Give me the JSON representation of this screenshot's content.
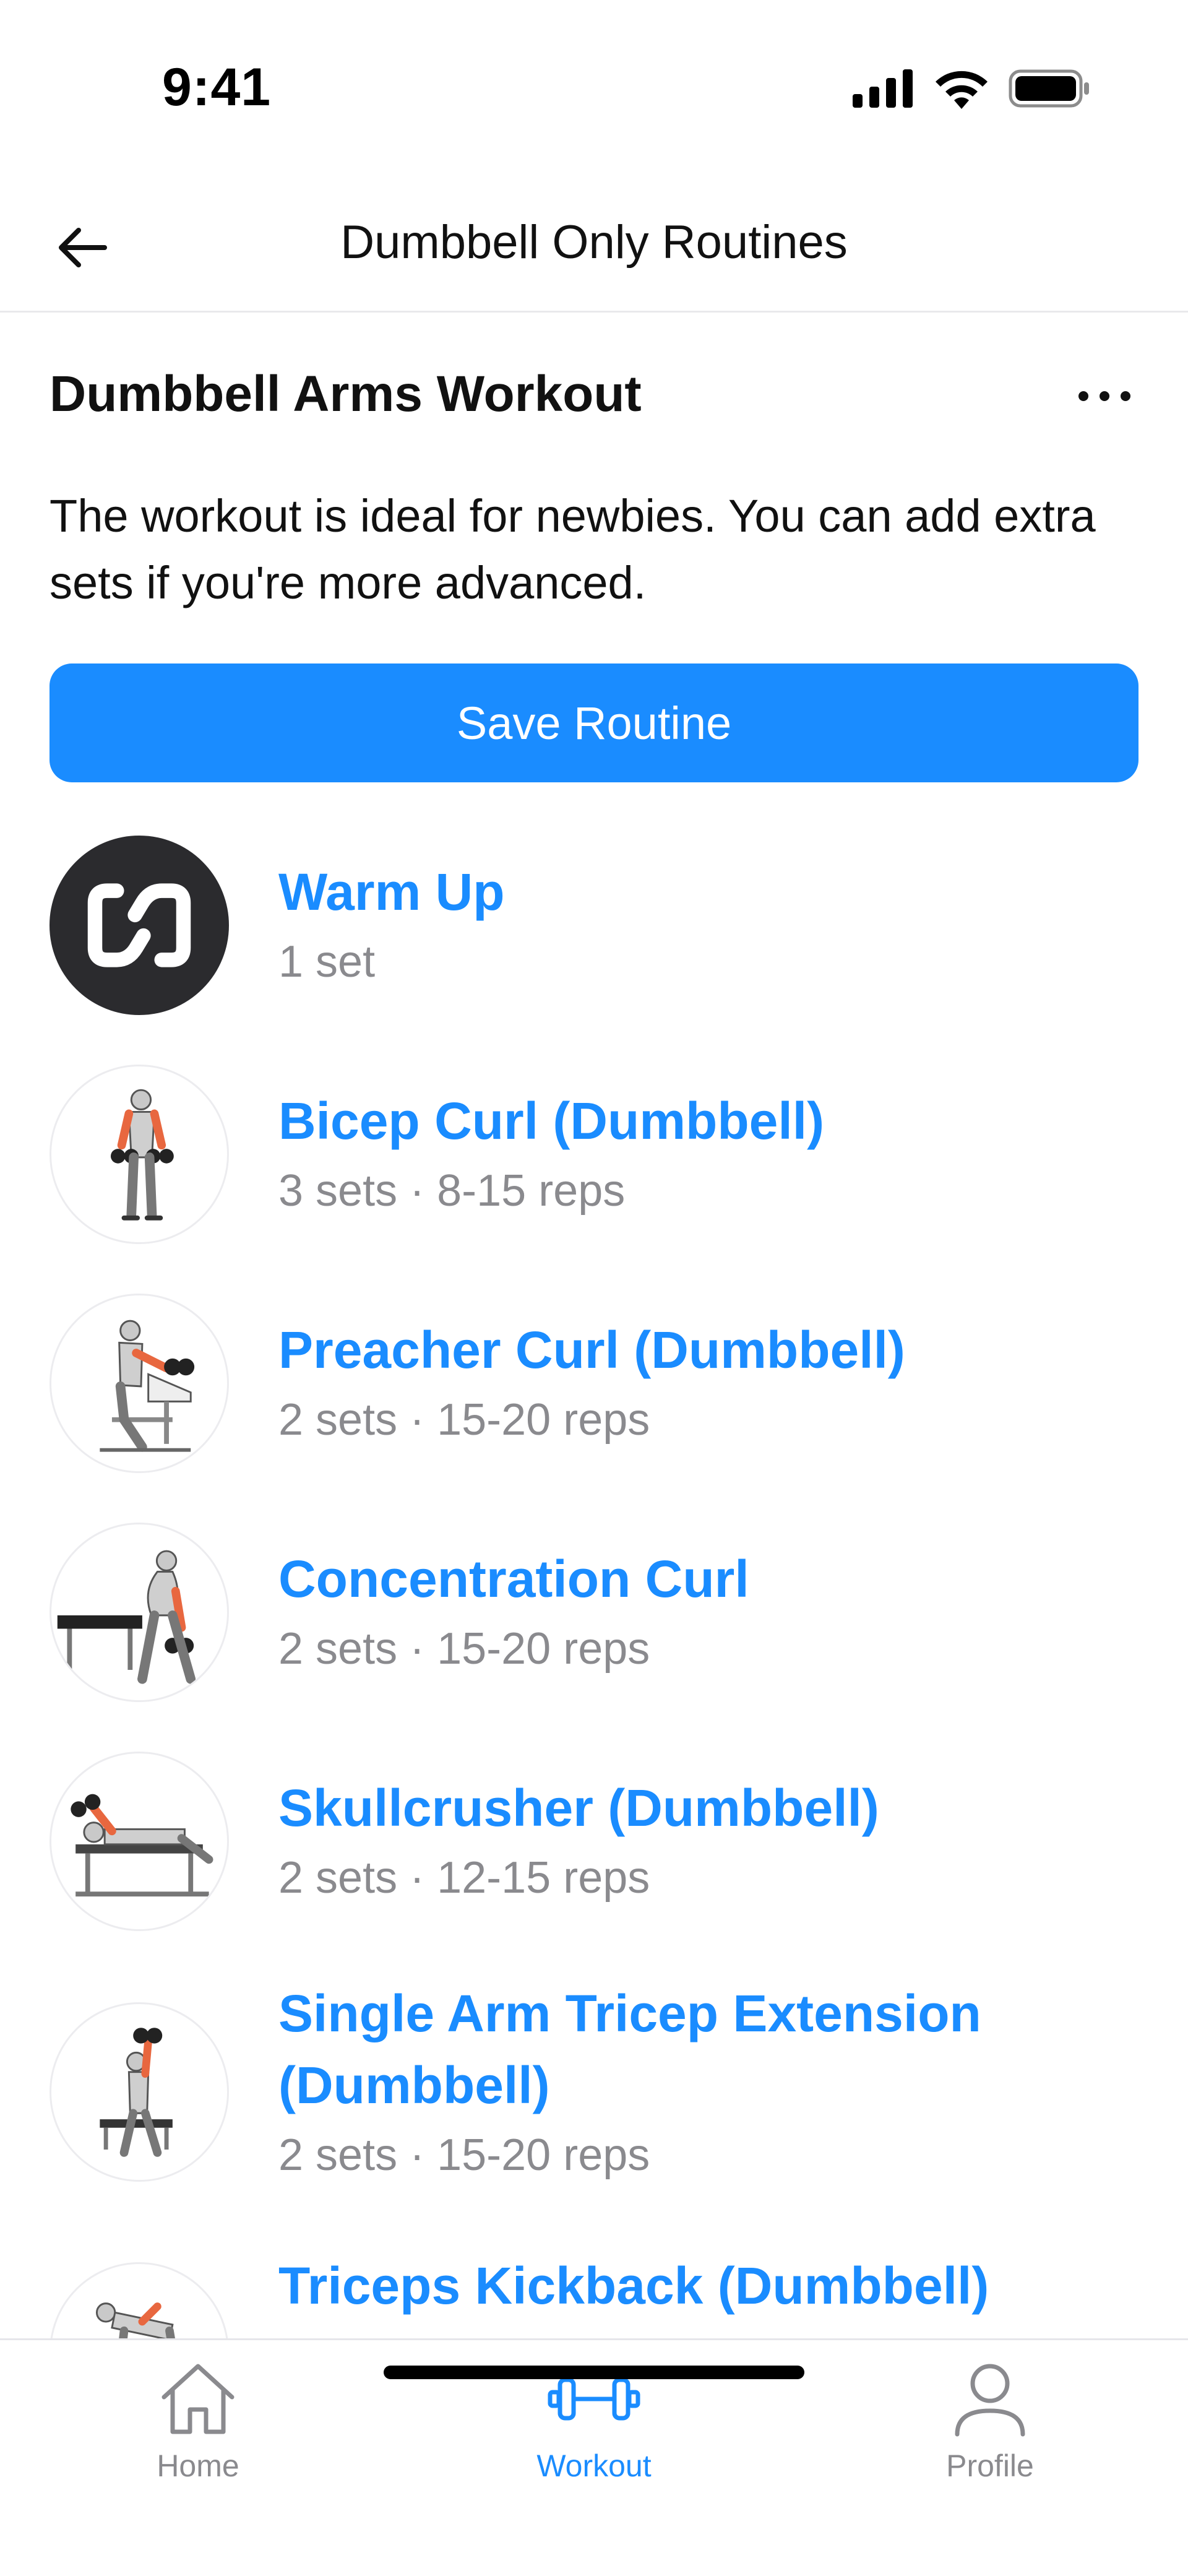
{
  "status_bar": {
    "time": "9:41",
    "icons": [
      "signal-icon",
      "wifi-icon",
      "battery-icon"
    ]
  },
  "header": {
    "back_icon": "arrow-left-icon",
    "title": "Dumbbell Only Routines"
  },
  "routine": {
    "title": "Dumbbell Arms Workout",
    "more_icon": "more-horizontal-icon",
    "description": "The workout is ideal for newbies. You can add extra sets if you're more advanced.",
    "save_label": "Save Routine"
  },
  "exercises": [
    {
      "name": "Warm Up",
      "meta": "1 set",
      "icon": "warmup-logo-icon"
    },
    {
      "name": "Bicep Curl (Dumbbell)",
      "meta": "3 sets · 8-15 reps",
      "icon": "bicep-curl-illustration"
    },
    {
      "name": "Preacher Curl (Dumbbell)",
      "meta": "2 sets · 15-20 reps",
      "icon": "preacher-curl-illustration"
    },
    {
      "name": "Concentration Curl",
      "meta": "2 sets · 15-20 reps",
      "icon": "concentration-curl-illustration"
    },
    {
      "name": "Skullcrusher (Dumbbell)",
      "meta": "2 sets · 12-15 reps",
      "icon": "skullcrusher-illustration"
    },
    {
      "name": "Single Arm Tricep Extension (Dumbbell)",
      "meta": "2 sets · 15-20 reps",
      "icon": "tricep-extension-illustration"
    },
    {
      "name": "Triceps Kickback (Dumbbell)",
      "meta": "",
      "icon": "triceps-kickback-illustration"
    }
  ],
  "tab_bar": {
    "tabs": [
      {
        "label": "Home",
        "icon": "home-icon",
        "active": false
      },
      {
        "label": "Workout",
        "icon": "dumbbell-icon",
        "active": true
      },
      {
        "label": "Profile",
        "icon": "profile-icon",
        "active": false
      }
    ]
  },
  "colors": {
    "accent": "#1a8cff",
    "muted_text": "#8a8a8e",
    "warmup_bg": "#2b2b2e",
    "muscle_highlight": "#e8673f"
  }
}
